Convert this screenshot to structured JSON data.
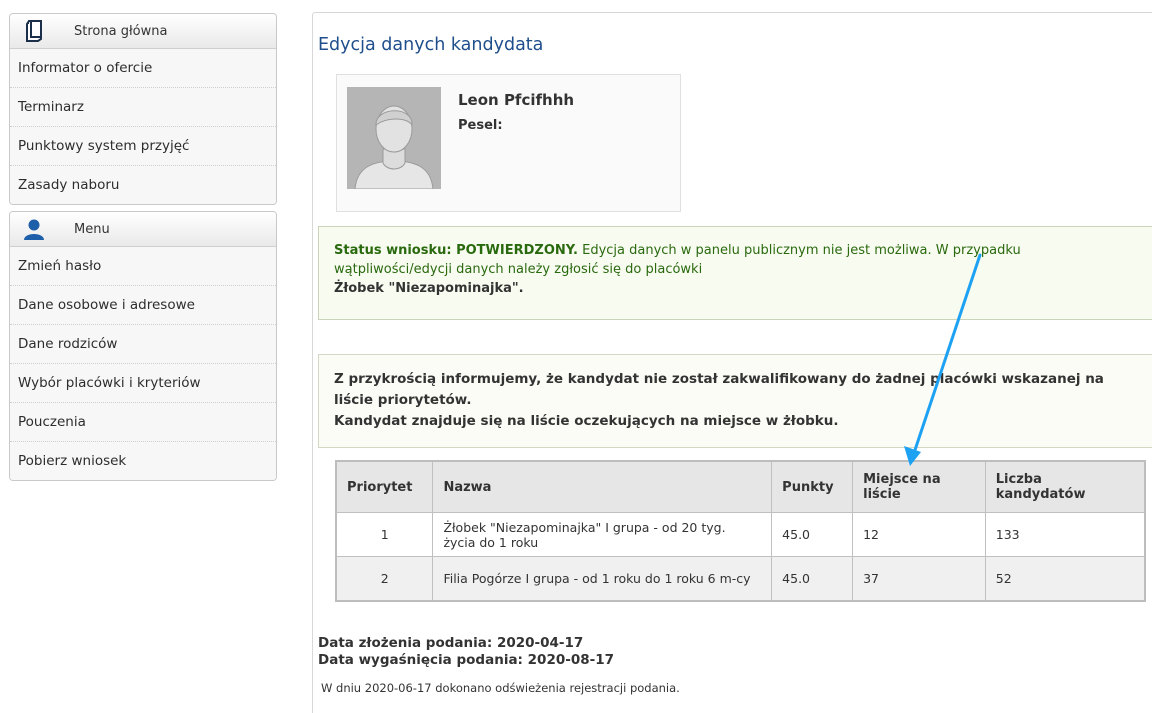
{
  "sidebar": {
    "home_panel": {
      "title": "Strona główna",
      "icon": "document-icon"
    },
    "home_items": [
      {
        "label": "Informator o ofercie"
      },
      {
        "label": "Terminarz"
      },
      {
        "label": "Punktowy system przyjęć"
      },
      {
        "label": "Zasady naboru"
      }
    ],
    "menu_panel": {
      "title": "Menu",
      "icon": "user-icon"
    },
    "menu_items": [
      {
        "label": "Zmień hasło"
      },
      {
        "label": "Dane osobowe i adresowe"
      },
      {
        "label": "Dane rodziców"
      },
      {
        "label": "Wybór placówki i kryteriów"
      },
      {
        "label": "Pouczenia"
      },
      {
        "label": "Pobierz wniosek"
      }
    ]
  },
  "main": {
    "title": "Edycja danych kandydata",
    "candidate": {
      "name": "Leon Pfcifhhh",
      "pesel_label": "Pesel:"
    },
    "status": {
      "label": "Status wniosku: POTWIERDZONY.",
      "text": " Edycja danych w panelu publicznym nie jest możliwa. W przypadku wątpliwości/edycji danych należy zgłosić się do placówki",
      "place": "Żłobek \"Niezapominajka\"."
    },
    "info": {
      "line1": "Z przykrością informujemy, że kandydat nie został zakwalifikowany do żadnej placówki wskazanej na liście priorytetów.",
      "line2": "Kandydat znajduje się na liście oczekujących na miejsce w żłobku."
    },
    "table": {
      "headers": [
        "Priorytet",
        "Nazwa",
        "Punkty",
        "Miejsce na liście",
        "Liczba kandydatów"
      ],
      "rows": [
        {
          "priority": "1",
          "name": "Żłobek \"Niezapominajka\" I grupa - od 20 tyg. życia do 1 roku",
          "points": "45.0",
          "place": "12",
          "count": "133"
        },
        {
          "priority": "2",
          "name": "Filia Pogórze I grupa - od 1 roku do 1 roku 6 m-cy",
          "points": "45.0",
          "place": "37",
          "count": "52"
        }
      ]
    },
    "dates": {
      "submitted": "Data złożenia podania: 2020-04-17",
      "expires": "Data wygaśnięcia podania: 2020-08-17"
    },
    "refresh_note": "W dniu 2020-06-17 dokonano odświeżenia rejestracji podania."
  },
  "colors": {
    "title": "#1f4e8c",
    "status_green": "#2a6a0f",
    "annotation_arrow": "#1da1f2"
  }
}
